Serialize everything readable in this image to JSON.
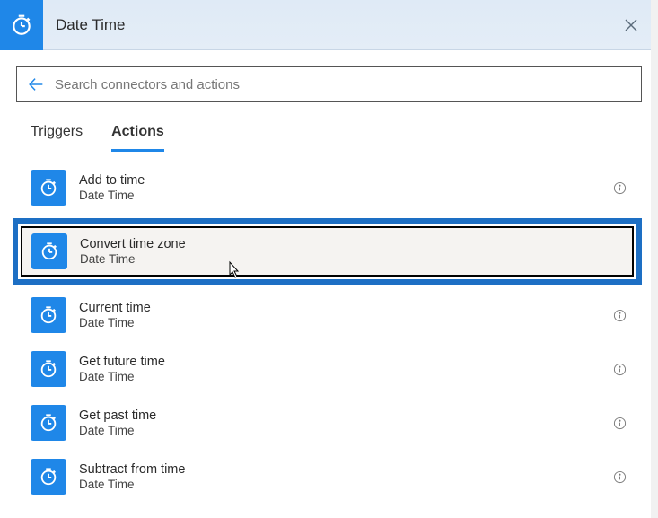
{
  "header": {
    "title": "Date Time",
    "close_label": "Close"
  },
  "search": {
    "placeholder": "Search connectors and actions",
    "value": ""
  },
  "tabs": [
    {
      "id": "triggers",
      "label": "Triggers",
      "active": false
    },
    {
      "id": "actions",
      "label": "Actions",
      "active": true
    }
  ],
  "actions": [
    {
      "title": "Add to time",
      "subtitle": "Date Time",
      "highlighted": false
    },
    {
      "title": "Convert time zone",
      "subtitle": "Date Time",
      "highlighted": true
    },
    {
      "title": "Current time",
      "subtitle": "Date Time",
      "highlighted": false
    },
    {
      "title": "Get future time",
      "subtitle": "Date Time",
      "highlighted": false
    },
    {
      "title": "Get past time",
      "subtitle": "Date Time",
      "highlighted": false
    },
    {
      "title": "Subtract from time",
      "subtitle": "Date Time",
      "highlighted": false
    }
  ],
  "colors": {
    "accent": "#1f87e8",
    "highlight_border": "#1d6fc4"
  }
}
